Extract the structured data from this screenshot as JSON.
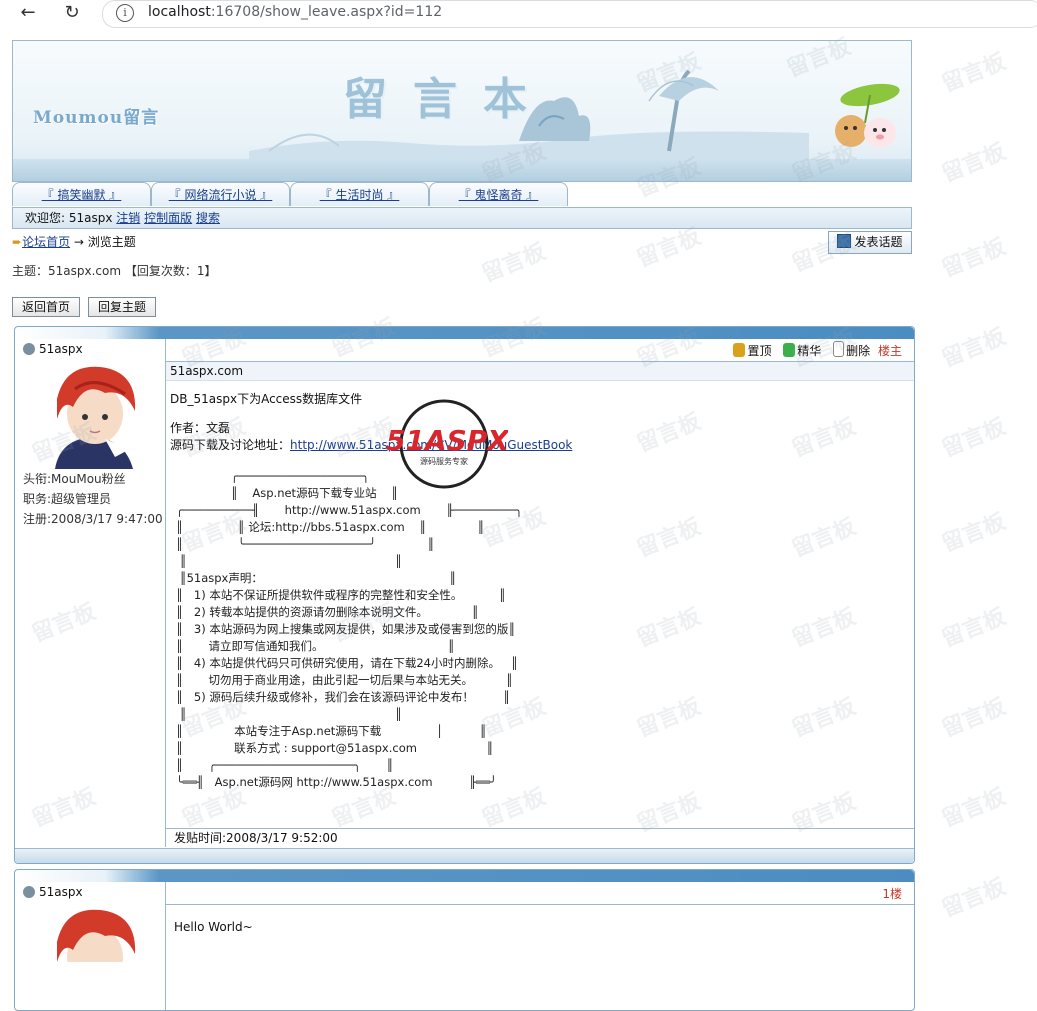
{
  "browser": {
    "url_host": "localhost",
    "url_rest": ":16708/show_leave.aspx?id=112"
  },
  "banner": {
    "logo": "Moumou留言",
    "title": "留言本"
  },
  "watermark": "留言板",
  "tabs": [
    "『 搞笑幽默 』",
    "『 网络流行小说 』",
    "『 生活时尚 』",
    "『 鬼怪离奇 』"
  ],
  "welcome": {
    "greeting": "欢迎您: 51aspx",
    "logout": "注销",
    "control_panel": "控制面版",
    "search": "搜索"
  },
  "breadcrumb": {
    "home": "论坛首页",
    "separator": "→",
    "current": "浏览主题",
    "post_button": "发表话题"
  },
  "subject_line": "主题：51aspx.com 【回复次数：1】",
  "buttons": {
    "back_home": "返回首页",
    "reply": "回复主题"
  },
  "posts": [
    {
      "username": "51aspx",
      "title_line": "头衔:MouMou粉丝",
      "role_line": "职务:超级管理员",
      "reg_line": "注册:2008/3/17 9:47:00",
      "actions": {
        "pin": "置顶",
        "elite": "精华",
        "delete": "删除"
      },
      "floor": "楼主",
      "subject": "51aspx.com",
      "line1": "DB_51aspx下为Access数据库文件",
      "author": "作者：文磊",
      "download_label": "源码下载及讨论地址：",
      "download_url": "http://www.51aspx.com/CV/MouMouGuestBook",
      "ascii_art": "               ╭──────────────────╮\n               ║    Asp.net源码下载专业站    ║\n╭──────────╢       http://www.51aspx.com       ╟─────────╮\n║               ║ 论坛:http://bbs.51aspx.com    ║              ║\n║               ╰──────────────────╯              ║\n ║                                                         ║\n ║51aspx声明：                                                   ║\n║   1) 本站不保证所提供软件或程序的完整性和安全性。          ║\n║   2) 转载本站提供的资源请勿删除本说明文件。            ║\n║   3) 本站源码为网上搜集或网友提供，如果涉及或侵害到您的版║\n║       请立即写信通知我们。                                  ║\n║   4) 本站提供代码只可供研究使用，请在下载24小时内删除。   ║\n║       切勿用于商业用途，由此引起一切后果与本站无关。         ║\n║   5) 源码后续升级或修补，我们会在该源码评论中发布！        ║\n ║                                                         ║\n║              本站专注于Asp.net源码下载               │          ║\n║              联系方式 : support@51aspx.com                   ║\n║       ╭────────────────────╮       ║\n╰══╢   Asp.net源码网 http://www.51aspx.com          ╟══╯",
      "post_time": "发贴时间:2008/3/17 9:52:00"
    },
    {
      "username": "51aspx",
      "floor": "1楼",
      "content": "Hello World~"
    }
  ],
  "stamp_logo": "51ASPX",
  "stamp_sub": "源码服务专家"
}
